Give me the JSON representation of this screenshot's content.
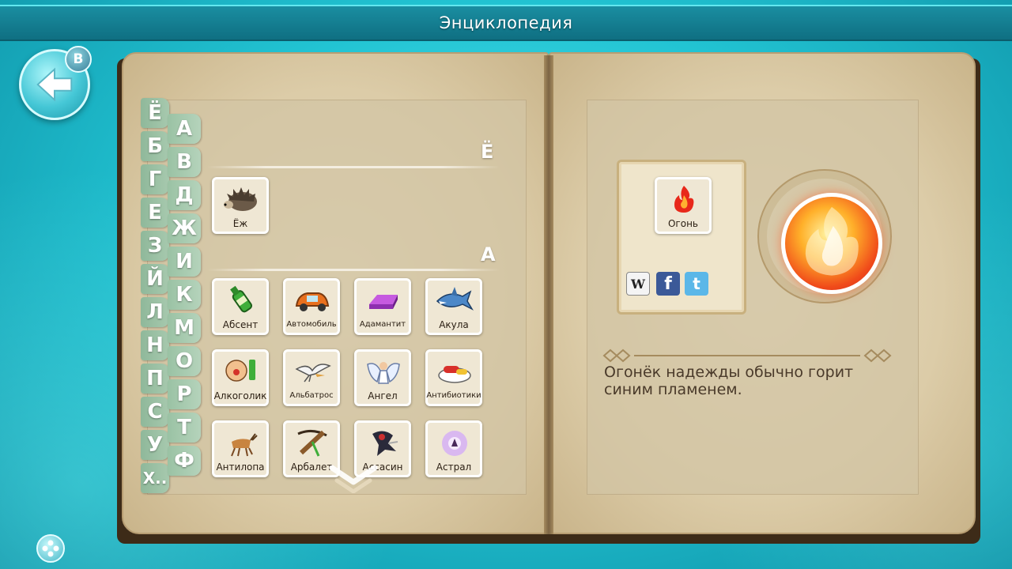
{
  "title": "Энциклопедия",
  "back_button": {
    "badge": "B"
  },
  "tabs": {
    "column1": [
      "Ё",
      "Б",
      "Г",
      "Е",
      "З",
      "Й",
      "Л",
      "Н",
      "П",
      "С",
      "У",
      "Х.."
    ],
    "column2": [
      "А",
      "В",
      "Д",
      "Ж",
      "И",
      "К",
      "М",
      "О",
      "Р",
      "Т",
      "Ф"
    ]
  },
  "sections": [
    {
      "letter": "Ё",
      "items": [
        {
          "name": "Ёж",
          "icon": "hedgehog-icon"
        }
      ]
    },
    {
      "letter": "А",
      "items": [
        {
          "name": "Абсент",
          "icon": "absinthe-bottle-icon"
        },
        {
          "name": "Автомобиль",
          "icon": "car-icon"
        },
        {
          "name": "Адамантит",
          "icon": "adamantite-ingot-icon"
        },
        {
          "name": "Акула",
          "icon": "shark-icon"
        },
        {
          "name": "Алкоголик",
          "icon": "alcoholic-icon"
        },
        {
          "name": "Альбатрос",
          "icon": "albatross-icon"
        },
        {
          "name": "Ангел",
          "icon": "angel-icon"
        },
        {
          "name": "Антибиотики",
          "icon": "antibiotics-icon"
        },
        {
          "name": "Антилопа",
          "icon": "antelope-icon"
        },
        {
          "name": "Арбалет",
          "icon": "crossbow-icon"
        },
        {
          "name": "Ассасин",
          "icon": "assassin-icon"
        },
        {
          "name": "Астрал",
          "icon": "astral-icon"
        }
      ]
    }
  ],
  "detail": {
    "element_name": "Огонь",
    "element_icon": "fire-icon",
    "description": "Огонёк надежды обычно горит синим пламенем.",
    "social": [
      "wikipedia-icon",
      "facebook-icon",
      "twitter-icon"
    ],
    "social_labels": {
      "wiki": "W",
      "facebook": "f",
      "twitter": "t"
    }
  },
  "colors": {
    "accent": "#22c4d3",
    "title_bar": "#0f6f82",
    "tab": "#a7c9ae",
    "paper": "#dccca8"
  }
}
